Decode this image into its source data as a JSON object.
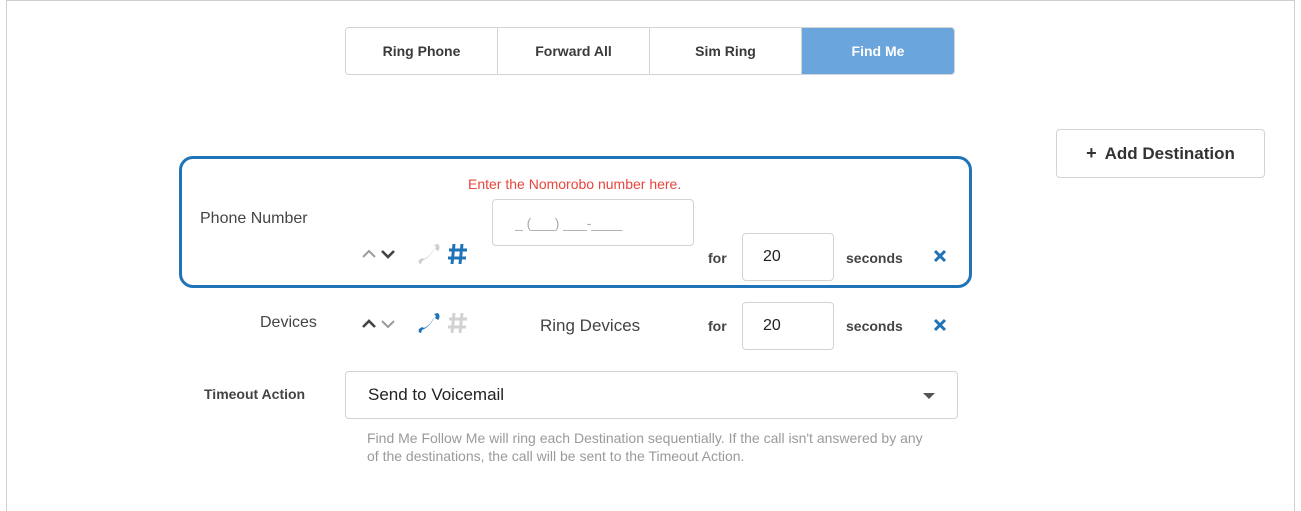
{
  "tabs": [
    {
      "label": "Ring Phone",
      "active": false
    },
    {
      "label": "Forward All",
      "active": false
    },
    {
      "label": "Sim Ring",
      "active": false
    },
    {
      "label": "Find Me",
      "active": true
    }
  ],
  "add_destination": {
    "label": "Add Destination",
    "icon": "+"
  },
  "phone_row": {
    "hint": "Enter the Nomorobo number here.",
    "label": "Phone Number",
    "placeholder": "_ (___) ___-____",
    "for_label": "for",
    "seconds_value": "20",
    "seconds_label": "seconds"
  },
  "devices_row": {
    "label": "Devices",
    "target": "Ring Devices",
    "for_label": "for",
    "seconds_value": "20",
    "seconds_label": "seconds"
  },
  "timeout": {
    "label": "Timeout Action",
    "selected": "Send to Voicemail",
    "help": "Find Me Follow Me will ring each Destination sequentially. If the call isn't answered by any of the destinations, the call will be sent to the Timeout Action."
  },
  "colors": {
    "accent": "#1f73b7",
    "active_tab": "#6aa5dc",
    "hint": "#e8453c"
  }
}
